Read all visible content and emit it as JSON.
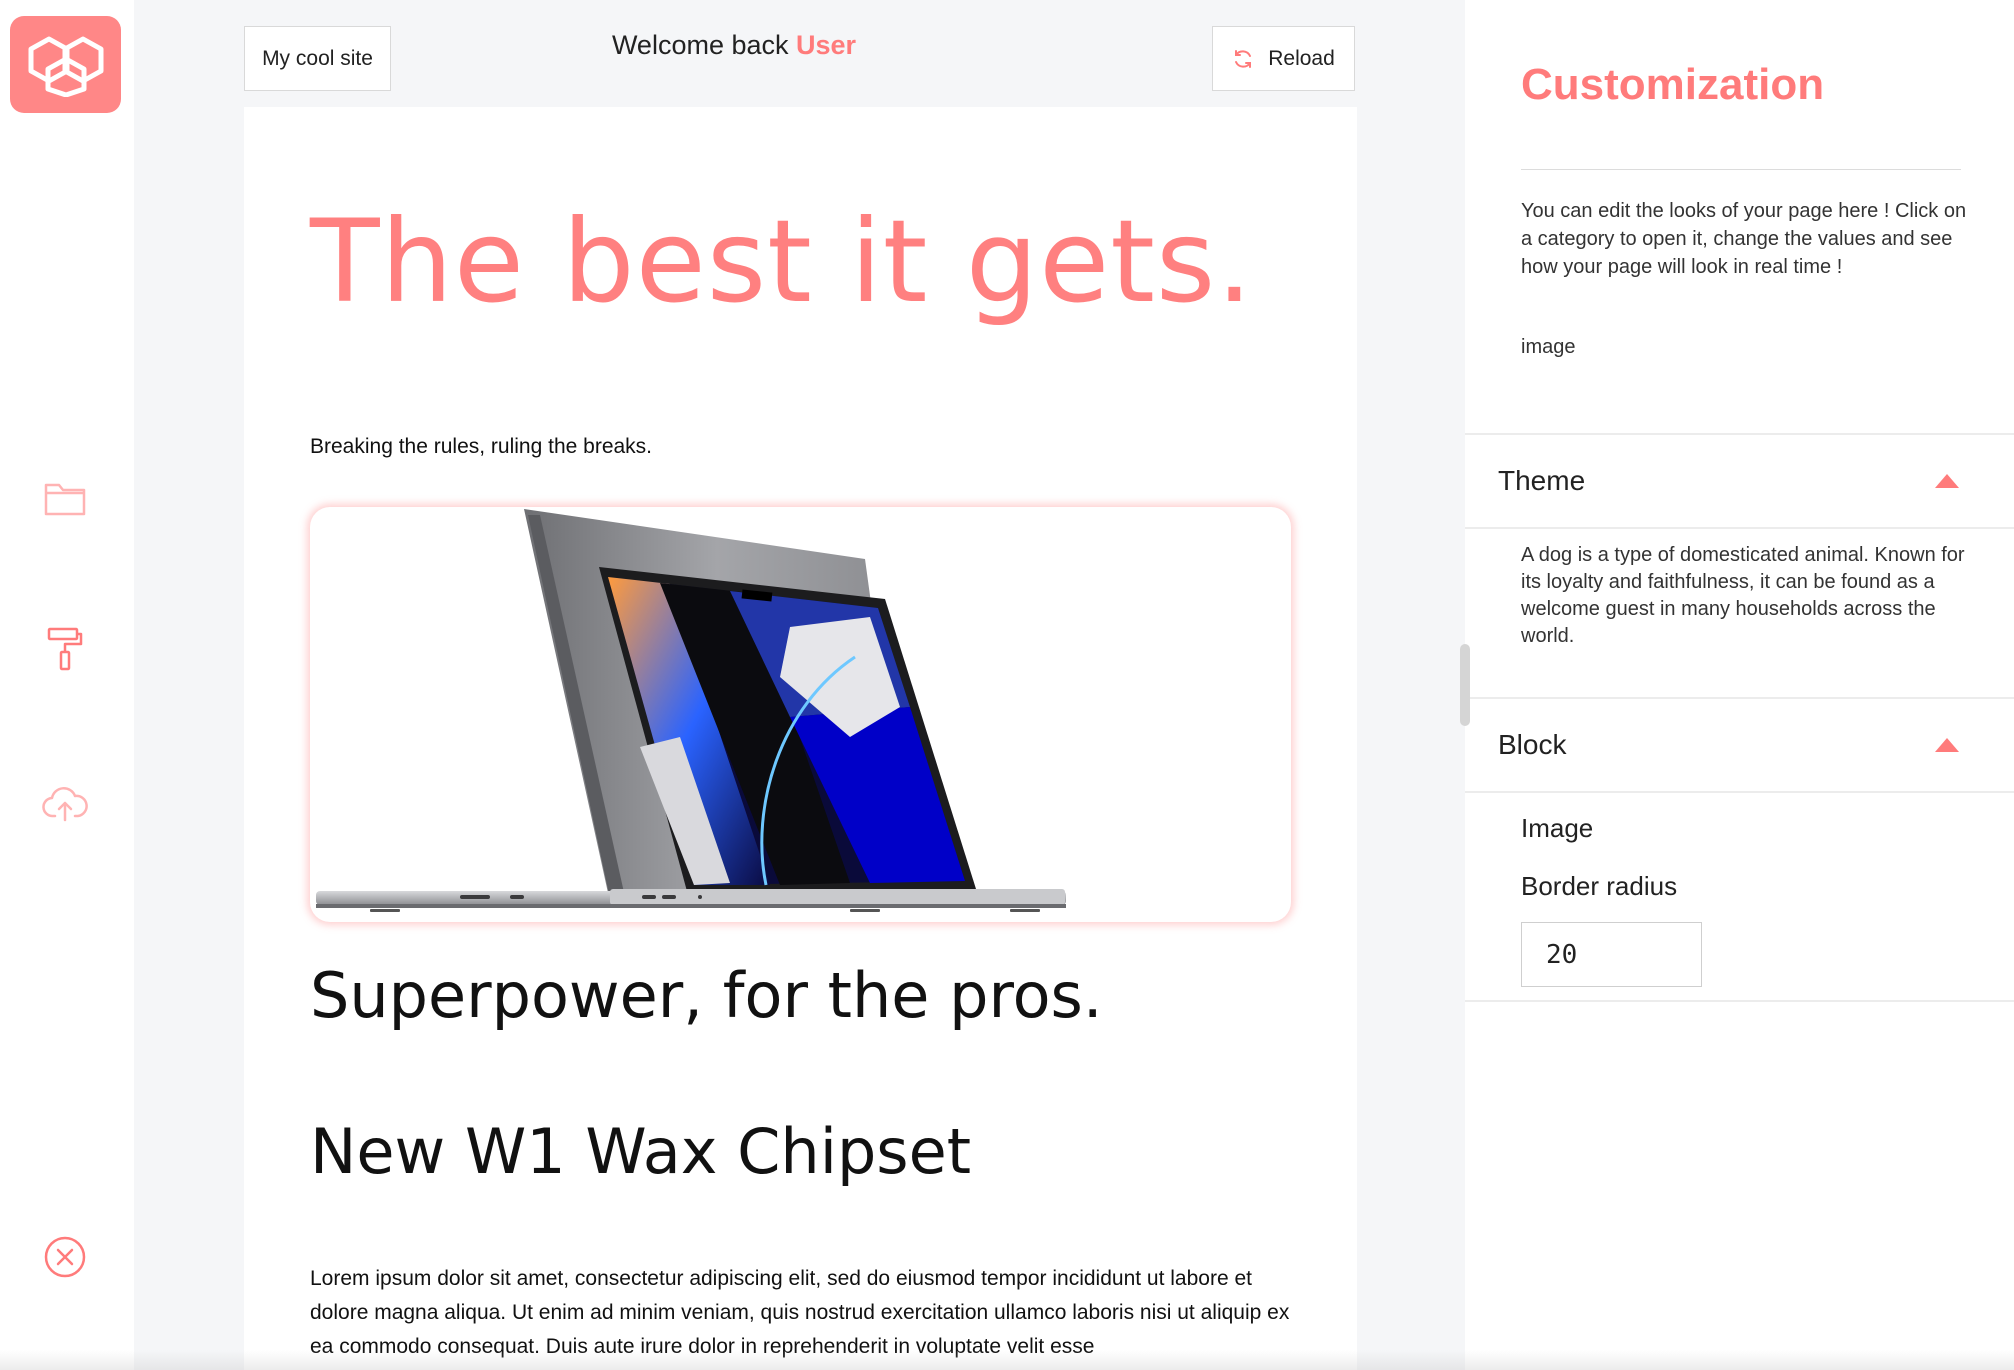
{
  "header": {
    "site_button_label": "My cool site",
    "welcome_text": "Welcome back ",
    "user_name": "User",
    "reload_label": "Reload"
  },
  "sidebar": {
    "logo_icon": "hexagon-logo-icon",
    "items": [
      {
        "icon": "folder-icon"
      },
      {
        "icon": "paint-roller-icon"
      },
      {
        "icon": "cloud-upload-icon"
      },
      {
        "icon": "close-circle-icon"
      }
    ]
  },
  "page": {
    "hero_title": "The best it gets.",
    "subtitle": "Breaking the rules, ruling the breaks.",
    "heading_1": "Superpower, for the pros.",
    "heading_2": "New W1 Wax Chipset",
    "body_text": "Lorem ipsum dolor sit amet, consectetur adipiscing elit, sed do eiusmod tempor incididunt ut labore et dolore magna aliqua. Ut enim ad minim veniam, quis nostrud exercitation ullamco laboris nisi ut aliquip ex ea commodo consequat. Duis aute irure dolor in reprehenderit in voluptate velit esse"
  },
  "panel": {
    "title": "Customization",
    "intro": "You can edit the looks of your page here ! Click on a category to open it, change the values and see how your page will look in real time !",
    "intro_image": "image",
    "sections": [
      {
        "label": "Theme",
        "description": "A dog is a type of domesticated animal. Known for its loyalty and faithfulness, it can be found as a welcome guest in many households across the world."
      },
      {
        "label": "Block",
        "image_label": "Image",
        "border_radius_label": "Border radius",
        "border_radius_value": "20"
      }
    ]
  },
  "colors": {
    "accent": "#ff7b7b",
    "canvas_bg": "#f5f6f8"
  }
}
